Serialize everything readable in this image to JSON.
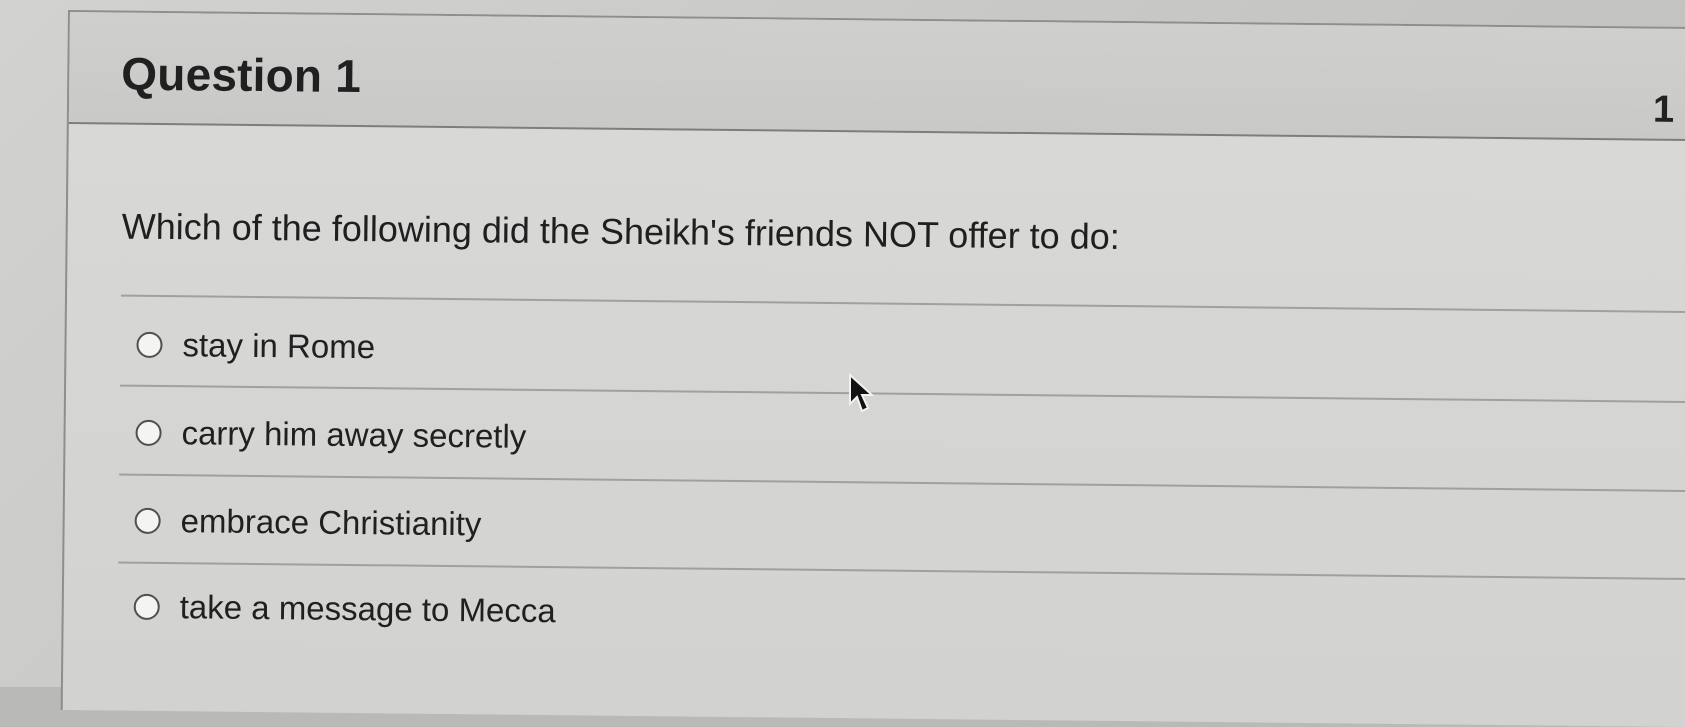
{
  "question": {
    "title": "Question 1",
    "points": "1",
    "prompt": "Which of the following did the Sheikh's friends NOT offer to do:",
    "options": [
      {
        "label": "stay in Rome"
      },
      {
        "label": "carry him away secretly"
      },
      {
        "label": "embrace Christianity"
      },
      {
        "label": "take a message to Mecca"
      }
    ]
  },
  "colors": {
    "background": "#c8c8c6",
    "text": "#202020",
    "border": "#8e8e8c"
  },
  "icons": {
    "radio": "radio-button-icon",
    "cursor": "mouse-pointer-icon"
  }
}
